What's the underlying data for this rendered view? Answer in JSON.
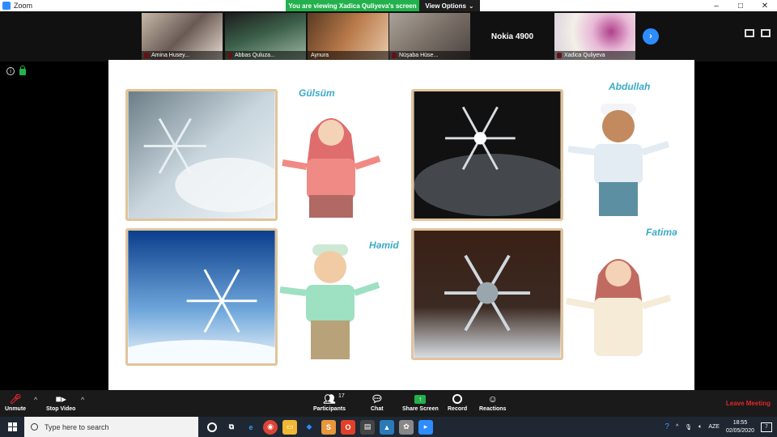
{
  "window": {
    "title": "Zoom",
    "banner": "You are viewing Xadica Quliyeva's screen",
    "view_options": "View Options",
    "controls": [
      "–",
      "□",
      "✕"
    ]
  },
  "participants": [
    {
      "name": "Amina Husey...",
      "muted": true,
      "bg": "#6a5a55"
    },
    {
      "name": "Abbas Quluza...",
      "muted": true,
      "bg": "#3b5e48"
    },
    {
      "name": "Aynura",
      "muted": false,
      "bg": "#b97a4a"
    },
    {
      "name": "Nüşaba Hüse...",
      "muted": true,
      "bg": "#7b7068"
    },
    {
      "name": "Nokia 4900",
      "muted": false,
      "text_only": true
    },
    {
      "name": "Xadica Quliyeva",
      "muted": true,
      "bg": "#d8d0dc",
      "active": true
    }
  ],
  "slide": {
    "names": [
      "Gülsüm",
      "Abdullah",
      "Həmid",
      "Fatimə"
    ]
  },
  "toolbar": {
    "unmute": "Unmute",
    "stop_video": "Stop Video",
    "participants": "Participants",
    "participants_count": "17",
    "chat": "Chat",
    "share_screen": "Share Screen",
    "record": "Record",
    "reactions": "Reactions",
    "leave": "Leave Meeting"
  },
  "taskbar": {
    "search_placeholder": "Type here to search",
    "lang": "AZE",
    "time": "18:55",
    "date": "02/05/2020",
    "notifications": "7"
  },
  "colors": {
    "accent": "#2d8cff",
    "banner_green": "#22b14c",
    "leave_red": "#e0262a",
    "name_blue": "#3aaac7"
  }
}
